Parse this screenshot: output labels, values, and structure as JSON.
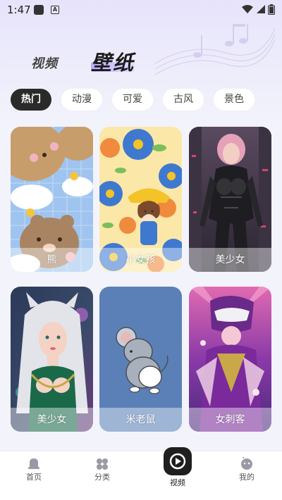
{
  "status_bar": {
    "time": "1:47"
  },
  "top_tabs": {
    "video": "视频",
    "wallpaper": "壁纸"
  },
  "categories": [
    {
      "label": "热门",
      "active": true
    },
    {
      "label": "动漫",
      "active": false
    },
    {
      "label": "可爱",
      "active": false
    },
    {
      "label": "古风",
      "active": false
    },
    {
      "label": "景色",
      "active": false
    }
  ],
  "wallpapers": [
    {
      "label": "熊"
    },
    {
      "label": "小女孩"
    },
    {
      "label": "美少女"
    },
    {
      "label": "美少女"
    },
    {
      "label": "米老鼠"
    },
    {
      "label": "女刺客"
    }
  ],
  "bottom_nav": [
    {
      "label": "首页",
      "icon": "home-icon"
    },
    {
      "label": "分类",
      "icon": "category-icon"
    },
    {
      "label": "视频",
      "icon": "video-icon"
    },
    {
      "label": "我的",
      "icon": "profile-icon"
    }
  ],
  "colors": {
    "accent": "#a996ff",
    "active_chip": "#2a2a2a",
    "background": "#f3f4fb"
  }
}
